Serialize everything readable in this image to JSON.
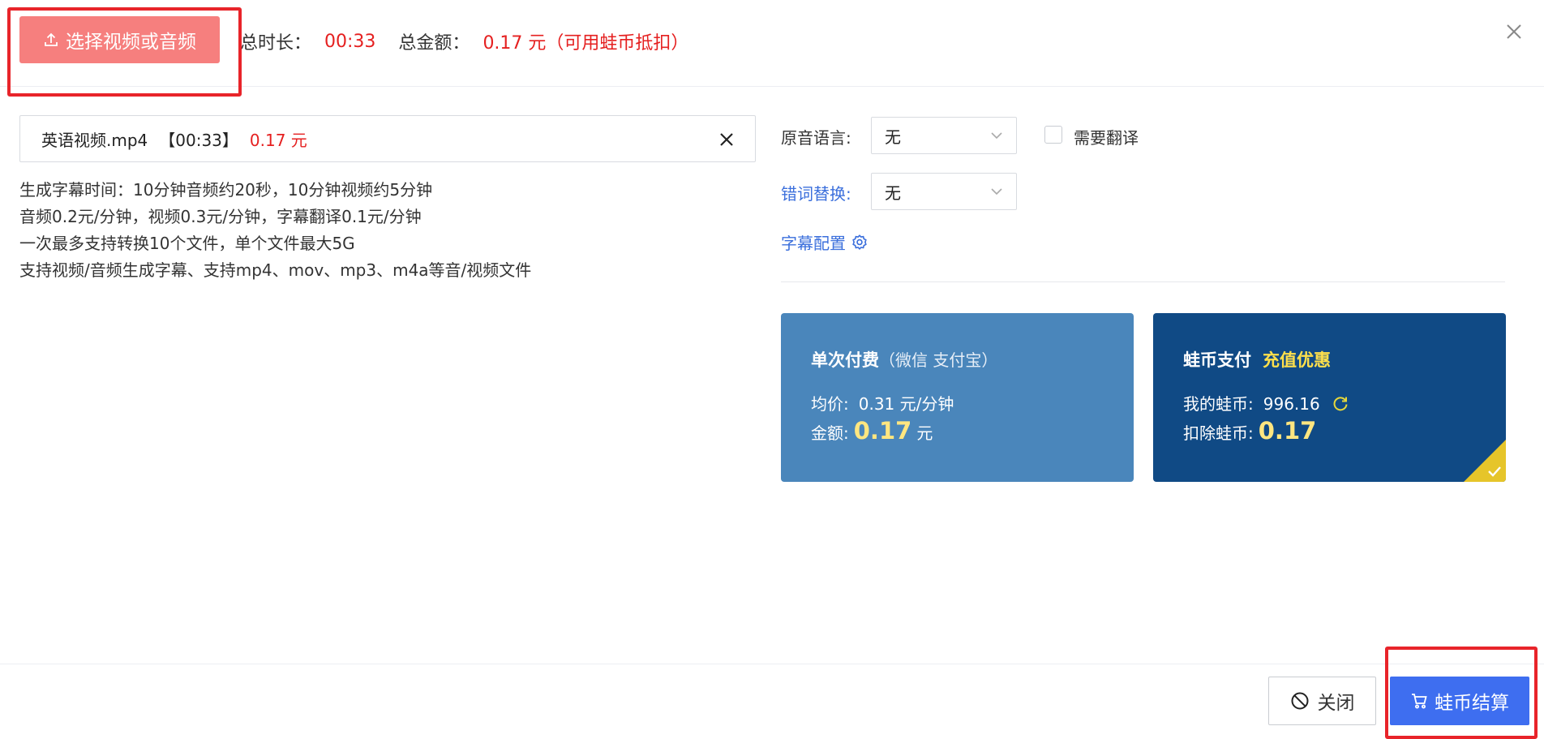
{
  "header": {
    "upload_button": "选择视频或音频",
    "duration_label": "总时长：",
    "duration_value": "00:33",
    "amount_label": "总金额：",
    "amount_value": "0.17 元（可用蛙币抵扣）"
  },
  "file": {
    "name": "英语视频.mp4",
    "duration": "【00:33】",
    "price": "0.17 元"
  },
  "notes": [
    "生成字幕时间：10分钟音频约20秒，10分钟视频约5分钟",
    "音频0.2元/分钟，视频0.3元/分钟，字幕翻译0.1元/分钟",
    "一次最多支持转换10个文件，单个文件最大5G",
    "支持视频/音频生成字幕、支持mp4、mov、mp3、m4a等音/视频文件"
  ],
  "settings": {
    "source_language_label": "原音语言:",
    "source_language_value": "无",
    "translate_label": "需要翻译",
    "typo_replace_label": "错词替换:",
    "typo_replace_value": "无",
    "subtitle_config_label": "字幕配置"
  },
  "payment": {
    "single": {
      "title": "单次付费",
      "subtitle": "（微信 支付宝）",
      "unit_price_label": "均价:",
      "unit_price_value": "0.31 元/分钟",
      "amount_label": "金额:",
      "amount_value": "0.17",
      "amount_unit": "元"
    },
    "coin": {
      "title": "蛙币支付",
      "promo": "充值优惠",
      "balance_label": "我的蛙币:",
      "balance_value": "996.16",
      "deduct_label": "扣除蛙币:",
      "deduct_value": "0.17",
      "selected": true
    }
  },
  "footer": {
    "close_label": "关闭",
    "pay_label": "蛙币结算"
  },
  "colors": {
    "upload_button": "#f67f7e",
    "highlight_red": "#e52020",
    "link_blue": "#3b6fdc",
    "card_single": "#4a86bb",
    "card_coin": "#104a85",
    "pay_button": "#3e6ef0",
    "corner_badge": "#e6c52a"
  },
  "icons": {
    "upload": "upload-icon",
    "close_dialog": "close-icon",
    "remove_file": "remove-file-icon",
    "dropdown": "chevron-down-icon",
    "settings": "gear-icon",
    "refresh": "refresh-icon",
    "selected_check": "check-icon",
    "forbidden": "ban-icon",
    "cart": "cart-icon"
  }
}
